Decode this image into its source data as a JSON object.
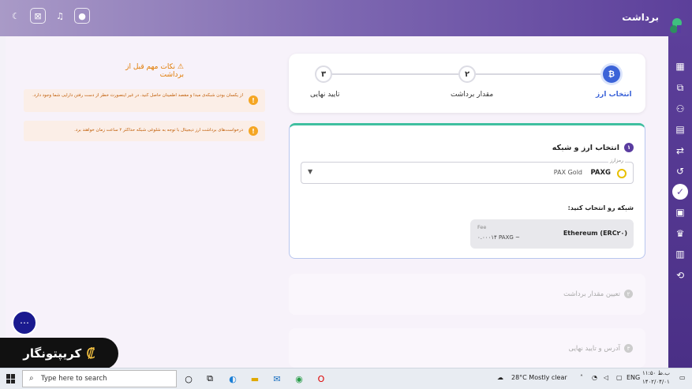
{
  "header": {
    "title": "برداشت"
  },
  "top_icons": [
    "moon-icon",
    "profile-card-icon",
    "notification-icon",
    "user-icon"
  ],
  "sidebar_icons": [
    "dashboard-icon",
    "chart-icon",
    "users-icon",
    "orders-icon",
    "exchange-icon",
    "deposit-icon",
    "withdraw-icon",
    "wallet-icon",
    "crown-icon",
    "document-icon",
    "settings-icon"
  ],
  "stepper": {
    "steps": [
      {
        "num": "₿",
        "label": "انتخاب ارز",
        "active": true
      },
      {
        "num": "۲",
        "label": "مقدار برداشت",
        "active": false
      },
      {
        "num": "۳",
        "label": "تایید نهایی",
        "active": false
      }
    ]
  },
  "currency": {
    "step_num": "۱",
    "title": "انتخاب ارز و شبکه",
    "field_label": "رمزارز",
    "symbol": "PAXG",
    "name": "PAX Gold",
    "network_prompt": "شبکه رو انتخاب کنید:",
    "network": {
      "name": "Ethereum (ERC۲۰)",
      "fee_label": "Fee",
      "fee_value": "۰.۰۰۰۱۴ PAXG ~"
    }
  },
  "amount_section": {
    "num": "۲",
    "label": "تعیین مقدار برداشت"
  },
  "address_section": {
    "num": "۳",
    "label": "آدرس و تایید نهایی"
  },
  "notes": {
    "title": "نکات مهم قبل از برداشت",
    "items": [
      "از یکسان بودن شبکه‌ی مبدا و مقصد اطمینان حاصل کنید. در غیر اینصورت خطر از دست رفتن دارایی شما وجود دارد.",
      "درخواست‌های برداشت ارز دیجیتال با توجه به شلوغی شبکه حداکثر ۲ ساعت زمان خواهند برد."
    ]
  },
  "brand": {
    "name": "کریپتونگار"
  },
  "taskbar": {
    "search_placeholder": "Type here to search",
    "weather": "28°C  Mostly clear",
    "lang": "ENG",
    "time": "ب.ظ ۱۱:۵۰",
    "date": "۱۴۰۲/۰۴/۰۱"
  }
}
